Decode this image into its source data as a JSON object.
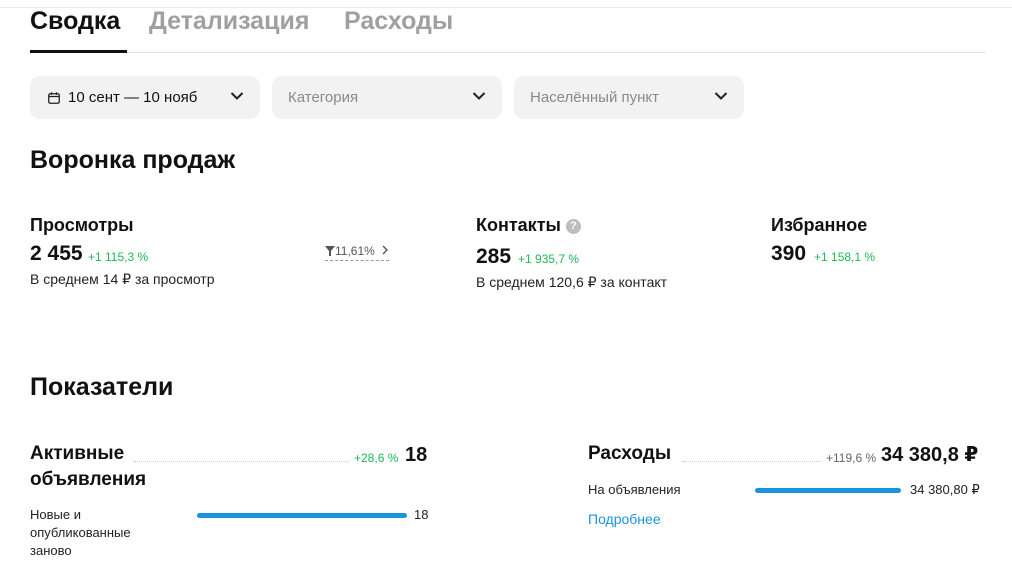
{
  "tabs": [
    {
      "label": "Сводка"
    },
    {
      "label": "Детализация"
    },
    {
      "label": "Расходы"
    }
  ],
  "filters": {
    "date": "10 сент — 10 нояб",
    "category_placeholder": "Категория",
    "location_placeholder": "Населённый пункт"
  },
  "funnel": {
    "title": "Воронка продаж",
    "views": {
      "title": "Просмотры",
      "value": "2 455",
      "delta": "+1 115,3 %",
      "sub": "В среднем 14 ₽ за просмотр"
    },
    "conversion": "11,61%",
    "contacts": {
      "title": "Контакты",
      "help": "?",
      "value": "285",
      "delta": "+1 935,7 %",
      "sub": "В среднем 120,6 ₽ за контакт"
    },
    "favorites": {
      "title": "Избранное",
      "value": "390",
      "delta": "+1 158,1 %"
    }
  },
  "indicators": {
    "title": "Показатели",
    "active": {
      "title": "Активные объявления",
      "delta": "+28,6 %",
      "value": "18",
      "row_label": "Новые и опубликованные заново",
      "row_value": "18",
      "bar_fraction": 1.0
    },
    "expenses": {
      "title": "Расходы",
      "delta": "+119,6 %",
      "value": "34 380,8 ₽",
      "row_label": "На объявления",
      "row_value": "34 380,80 ₽",
      "bar_fraction": 1.0,
      "more_link": "Подробнее"
    }
  },
  "colors": {
    "accent_blue": "#1a94e0",
    "delta_green": "#1db954",
    "filter_bg": "#f2f2f2"
  }
}
